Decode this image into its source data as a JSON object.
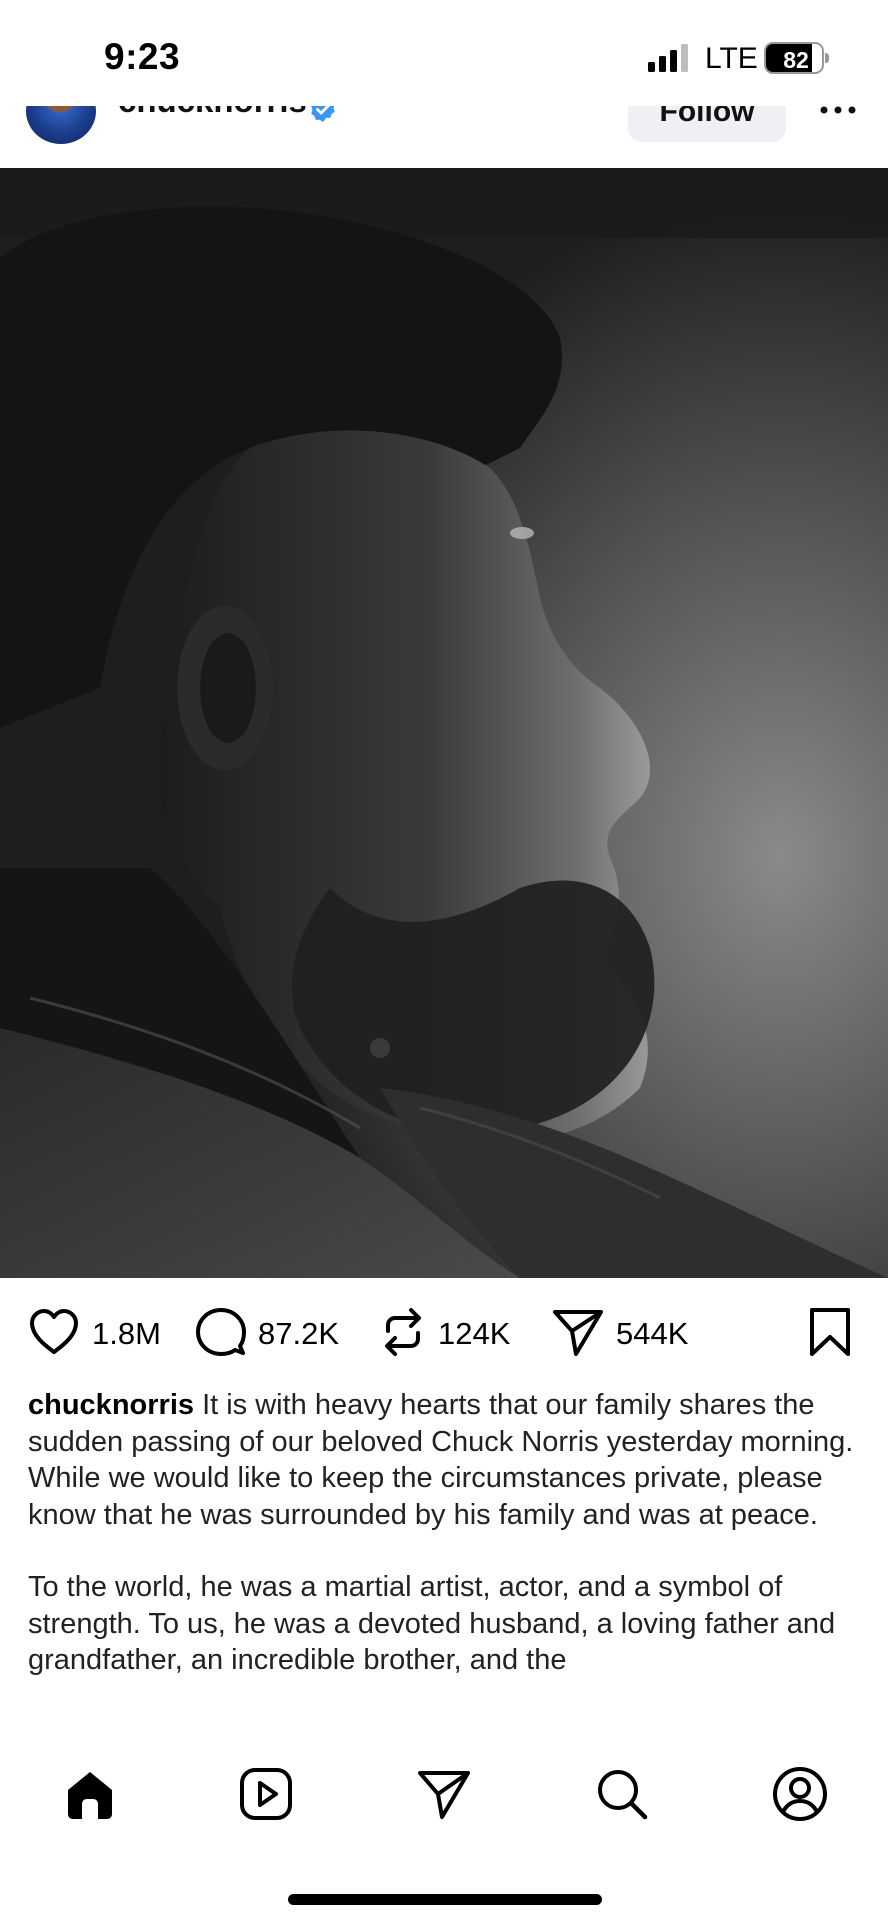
{
  "status_bar": {
    "time": "9:23",
    "network": "LTE",
    "battery_percent": "82",
    "battery_level": 0.82
  },
  "post": {
    "username": "chucknorris",
    "verified": true,
    "follow_label": "Follow",
    "actions": {
      "likes": "1.8M",
      "comments": "87.2K",
      "reposts": "124K",
      "shares": "544K"
    },
    "caption": {
      "username": "chucknorris",
      "paragraph_1": "It is with heavy hearts that our family shares the sudden passing of our beloved Chuck Norris yesterday morning. While we would like to keep the circumstances private, please know that he was surrounded by his family and was at peace.",
      "paragraph_2": "To the world, he was a martial artist, actor, and a symbol of strength. To us, he was a devoted husband, a loving father and grandfather, an incredible brother, and the"
    }
  },
  "bottom_nav": {
    "items": [
      "home-icon",
      "reels-icon",
      "send-icon",
      "search-icon",
      "profile-icon"
    ],
    "active": "home-icon"
  },
  "colors": {
    "accent_verified": "#3897f0",
    "follow_bg": "#efeff4",
    "text": "#000000"
  }
}
